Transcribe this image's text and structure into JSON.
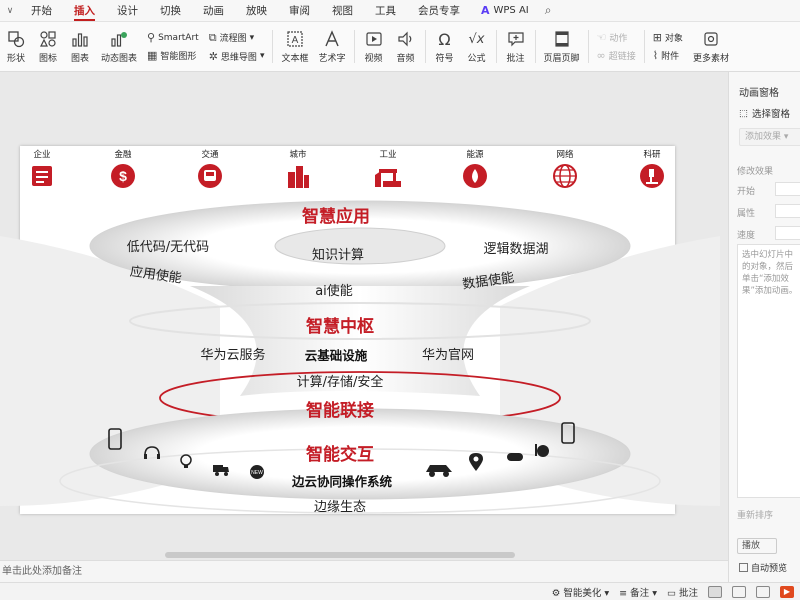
{
  "menu": {
    "tabs": [
      "开始",
      "插入",
      "设计",
      "切换",
      "动画",
      "放映",
      "审阅",
      "视图",
      "工具",
      "会员专享"
    ],
    "active_tab": "插入",
    "wps_ai": "WPS AI"
  },
  "ribbon": {
    "shape": "形状",
    "icon": "图标",
    "chart": "图表",
    "dynamic_chart": "动态图表",
    "smartart": "SmartArt",
    "smart_shape": "智能图形",
    "flowchart": "流程图",
    "mindmap": "思维导图",
    "textbox": "文本框",
    "wordart": "艺术字",
    "video": "视频",
    "audio": "音频",
    "symbol": "符号",
    "formula": "公式",
    "comment": "批注",
    "header_footer": "页眉页脚",
    "action": "动作",
    "hyperlink": "超链接",
    "object": "对象",
    "attachment": "附件",
    "more_material": "更多素材"
  },
  "slide": {
    "categories": [
      {
        "label": "企业",
        "icon": "enterprise-icon"
      },
      {
        "label": "金融",
        "icon": "finance-icon"
      },
      {
        "label": "交通",
        "icon": "traffic-icon"
      },
      {
        "label": "城市",
        "icon": "city-icon"
      },
      {
        "label": "工业",
        "icon": "industry-icon"
      },
      {
        "label": "能源",
        "icon": "energy-icon"
      },
      {
        "label": "网络",
        "icon": "network-icon"
      },
      {
        "label": "科研",
        "icon": "research-icon"
      }
    ],
    "layer1_title": "智慧应用",
    "low_code": "低代码/无代码",
    "knowledge": "知识计算",
    "data_lake": "逻辑数据湖",
    "app_enable": "应用使能",
    "ai_enable": "ai使能",
    "data_enable": "数据使能",
    "layer2_title": "智慧中枢",
    "huawei_cloud_service": "华为云服务",
    "cloud_infra": "云基础设施",
    "huawei_official": "华为官网",
    "compute_storage": "计算/存储/安全",
    "layer3_title": "智能联接",
    "layer4_title": "智能交互",
    "edge_os": "边云协同操作系统",
    "edge_eco": "边缘生态",
    "accent_color": "#c41d26"
  },
  "notes": {
    "placeholder": "单击此处添加备注"
  },
  "status": {
    "beautify": "智能美化",
    "notes": "备注",
    "comment": "批注"
  },
  "panel": {
    "title": "动画窗格",
    "select_pane": "选择窗格",
    "add_effect": "添加效果",
    "modify_effect": "修改效果",
    "start": "开始",
    "property": "属性",
    "speed": "速度",
    "hint": "选中幻灯片中的对象，然后单击“添加效果”添加动画。",
    "reorder": "重新排序",
    "play": "播放",
    "autopreview": "自动预览"
  }
}
